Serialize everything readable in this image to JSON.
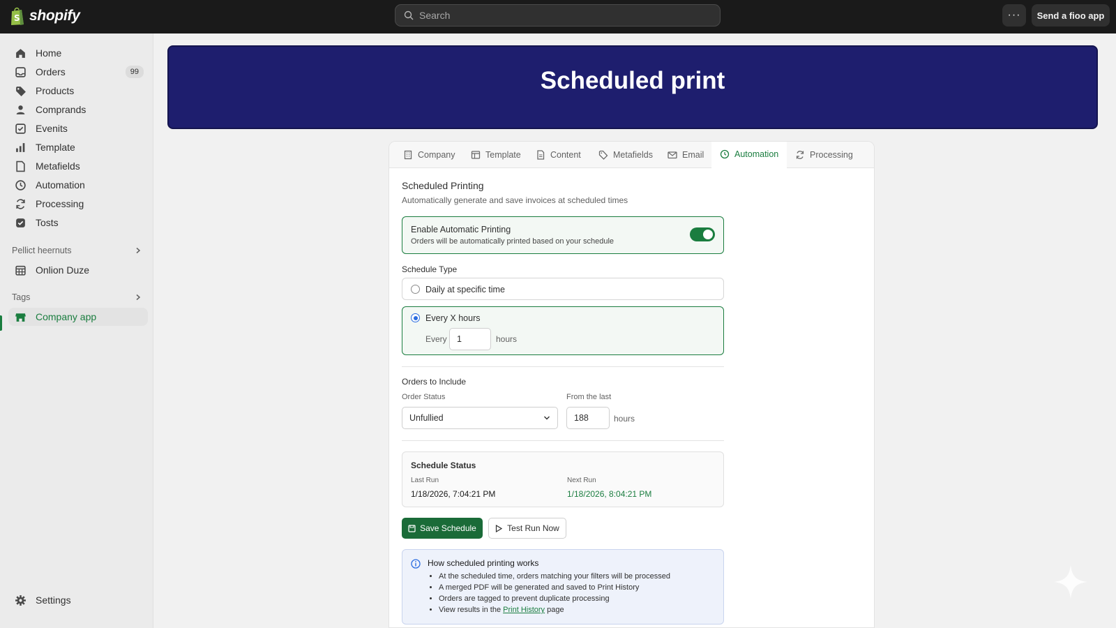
{
  "topbar": {
    "logo_text": "shopify",
    "search_placeholder": "Search",
    "more_label": "···",
    "send_button": "Send a fioo app"
  },
  "sidebar": {
    "items": [
      {
        "label": "Home",
        "icon": "home-icon"
      },
      {
        "label": "Orders",
        "icon": "orders-icon",
        "badge": "99"
      },
      {
        "label": "Products",
        "icon": "tag-icon"
      },
      {
        "label": "Comprands",
        "icon": "person-icon"
      },
      {
        "label": "Evenits",
        "icon": "events-icon"
      },
      {
        "label": "Template",
        "icon": "chart-icon"
      },
      {
        "label": "Metafields",
        "icon": "file-icon"
      },
      {
        "label": "Automation",
        "icon": "clock-icon"
      },
      {
        "label": "Processing",
        "icon": "refresh-icon"
      },
      {
        "label": "Tosts",
        "icon": "check-icon"
      }
    ],
    "section1": {
      "title": "Pellict heernuts",
      "item": "Onlion Duze"
    },
    "section2": {
      "title": "Tags",
      "item": "Company app"
    },
    "settings": "Settings"
  },
  "banner": {
    "title": "Scheduled print"
  },
  "tabs": [
    {
      "label": "Company",
      "icon": "building-icon"
    },
    {
      "label": "Template",
      "icon": "template-icon"
    },
    {
      "label": "Content",
      "icon": "document-icon"
    },
    {
      "label": "Metafields",
      "icon": "tag-icon"
    },
    {
      "label": "Email",
      "icon": "mail-icon"
    },
    {
      "label": "Automation",
      "icon": "clock-icon",
      "active": true
    },
    {
      "label": "Processing",
      "icon": "refresh-icon"
    }
  ],
  "automation": {
    "title": "Scheduled Printing",
    "subtitle": "Automatically generate and save invoices at scheduled times",
    "enable_title": "Enable Automatic Printing",
    "enable_sub": "Orders will be automatically printed based on your schedule",
    "enabled": true,
    "schedule_type_label": "Schedule Type",
    "option_daily": "Daily at specific time",
    "option_hours": "Every X hours",
    "every_label": "Every",
    "every_value": "1",
    "hours_label": "hours",
    "orders_label": "Orders to Include",
    "order_status_label": "Order Status",
    "order_status_value": "Unfullied",
    "from_last_label": "From the last",
    "from_last_value": "188",
    "from_last_unit": "hours",
    "status_title": "Schedule Status",
    "last_run_label": "Last Run",
    "last_run_value": "1/18/2026, 7:04:21 PM",
    "next_run_label": "Next Run",
    "next_run_value": "1/18/2026, 8:04:21 PM",
    "save_button": "Save Schedule",
    "test_button": "Test Run Now",
    "info_title": "How scheduled printing works",
    "info_items": [
      "At the scheduled time, orders matching your filters will be processed",
      "A merged PDF will be generated and saved to Print History",
      "Orders are tagged to prevent duplicate processing"
    ],
    "info_last_prefix": "View results in the",
    "info_last_link": "Print History",
    "info_last_suffix": "page"
  },
  "colors": {
    "accent": "#1a7d3f",
    "banner": "#1e1e6e",
    "topbar": "#1a1a1a"
  }
}
